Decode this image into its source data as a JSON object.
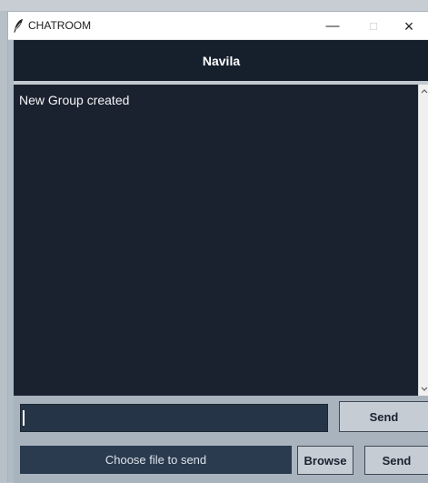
{
  "window": {
    "title": "CHATROOM",
    "controls": {
      "minimize": "—",
      "maximize": "□",
      "close": "×"
    }
  },
  "header": {
    "username": "Navila"
  },
  "chat": {
    "messages": [
      "New Group created"
    ]
  },
  "compose": {
    "input_value": "",
    "send_label": "Send"
  },
  "file": {
    "choose_label": "Choose file to send",
    "browse_label": "Browse",
    "send_label": "Send"
  },
  "icons": {
    "app": "feather-icon",
    "scroll_up": "scroll-up-arrow-icon",
    "scroll_down": "scroll-down-arrow-icon"
  },
  "colors": {
    "header_background": "#16202d",
    "chat_background": "#1b222f",
    "input_background": "#263447",
    "button_background": "#c5ccd4",
    "panel_background": "#a8b3be"
  }
}
